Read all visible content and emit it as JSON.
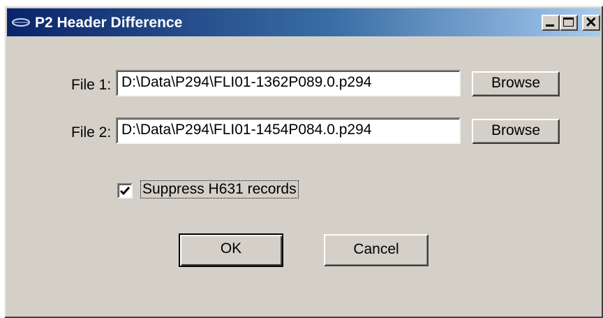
{
  "window": {
    "title": "P2 Header Difference",
    "controls": {
      "minimize_icon": "minimize-icon",
      "maximize_icon": "maximize-icon",
      "close_icon": "close-icon"
    }
  },
  "files": {
    "file1": {
      "label": "File 1:",
      "value": "D:\\Data\\P294\\FLI01-1362P089.0.p294",
      "browse_label": "Browse"
    },
    "file2": {
      "label": "File 2:",
      "value": "D:\\Data\\P294\\FLI01-1454P084.0.p294",
      "browse_label": "Browse"
    }
  },
  "options": {
    "suppress_label": "Suppress H631 records",
    "suppress_checked": true
  },
  "actions": {
    "ok_label": "OK",
    "cancel_label": "Cancel"
  },
  "colors": {
    "titlebar_start": "#0a246a",
    "titlebar_end": "#a6caf0",
    "dialog_face": "#d4d0c8"
  }
}
